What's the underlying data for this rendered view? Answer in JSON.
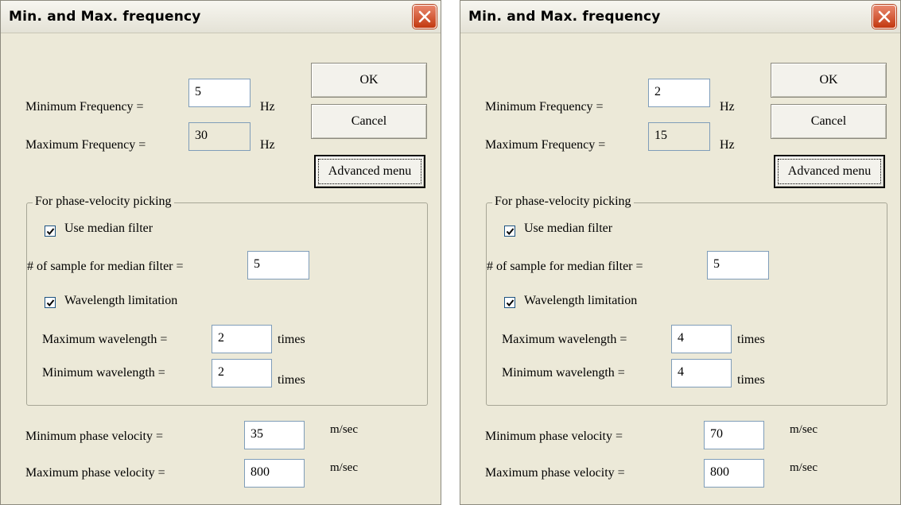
{
  "dialogs": [
    {
      "title": "Min. and Max. frequency",
      "min_freq_label": "Minimum Frequency =",
      "min_freq_value": "5",
      "max_freq_label": "Maximum Frequency =",
      "max_freq_value": "30",
      "freq_unit": "Hz",
      "ok_label": "OK",
      "cancel_label": "Cancel",
      "advanced_label": "Advanced menu",
      "group_label": "For phase-velocity picking",
      "median_filter_label": "Use median filter",
      "median_filter_checked": true,
      "median_samples_label": "# of sample for median filter =",
      "median_samples_value": "5",
      "wavelength_limit_label": "Wavelength limitation",
      "wavelength_limit_checked": true,
      "max_wavelength_label": "Maximum wavelength =",
      "max_wavelength_value": "2",
      "min_wavelength_label": "Minimum wavelength =",
      "min_wavelength_value": "2",
      "wavelength_unit": "times",
      "min_velocity_label": "Minimum phase velocity =",
      "min_velocity_value": "35",
      "max_velocity_label": "Maximum phase velocity =",
      "max_velocity_value": "800",
      "velocity_unit": "m/sec"
    },
    {
      "title": "Min. and Max. frequency",
      "min_freq_label": "Minimum Frequency =",
      "min_freq_value": "2",
      "max_freq_label": "Maximum Frequency =",
      "max_freq_value": "15",
      "freq_unit": "Hz",
      "ok_label": "OK",
      "cancel_label": "Cancel",
      "advanced_label": "Advanced menu",
      "group_label": "For phase-velocity picking",
      "median_filter_label": "Use median filter",
      "median_filter_checked": true,
      "median_samples_label": "# of sample for median filter =",
      "median_samples_value": "5",
      "wavelength_limit_label": "Wavelength limitation",
      "wavelength_limit_checked": true,
      "max_wavelength_label": "Maximum wavelength =",
      "max_wavelength_value": "4",
      "min_wavelength_label": "Minimum wavelength =",
      "min_wavelength_value": "4",
      "wavelength_unit": "times",
      "min_velocity_label": "Minimum phase velocity =",
      "min_velocity_value": "70",
      "max_velocity_label": "Maximum phase velocity =",
      "max_velocity_value": "800",
      "velocity_unit": "m/sec"
    }
  ],
  "colors": {
    "dialog_background": "#ece9d8",
    "close_button": "#c2380f",
    "field_border": "#7f9db9",
    "checkbox_border": "#1c5180"
  },
  "icons": {
    "close": "close-icon",
    "checkmark": "checkmark-icon"
  }
}
